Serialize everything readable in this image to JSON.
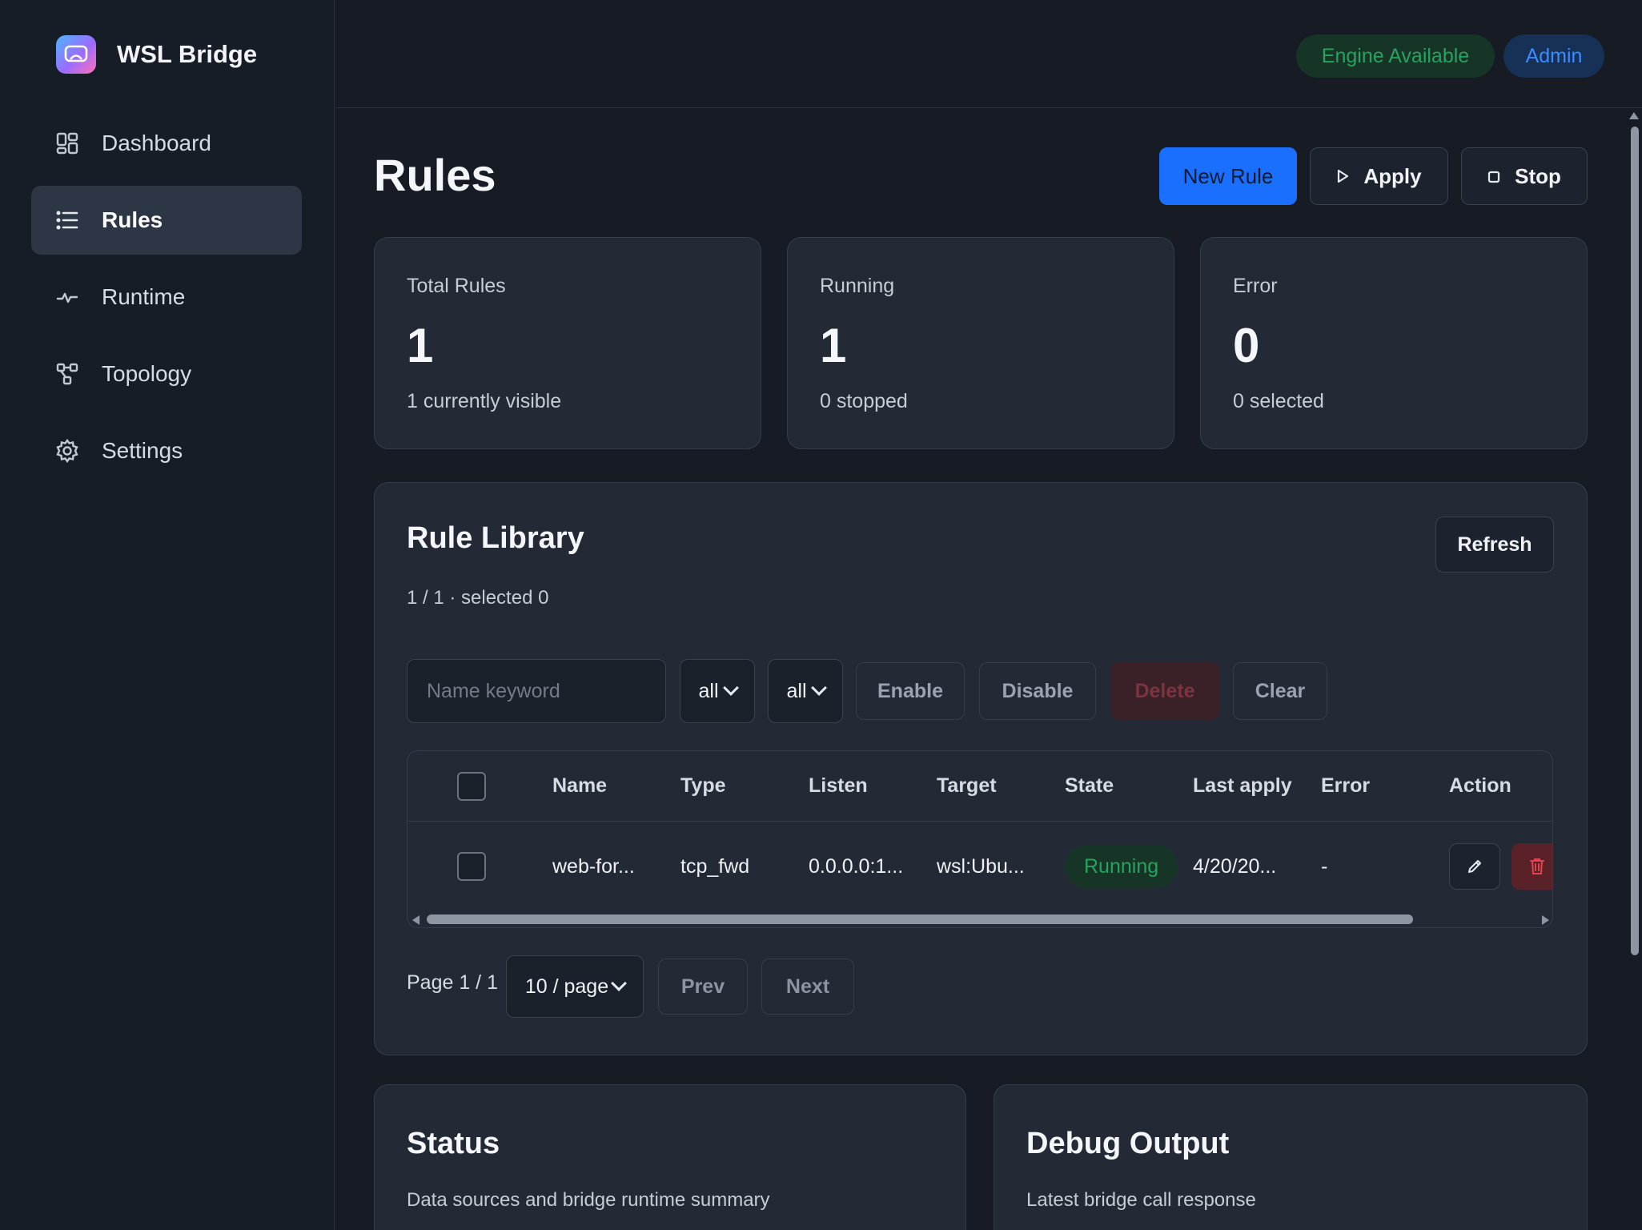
{
  "app": {
    "title": "WSL Bridge",
    "logo_icon": "bridge-logo-icon"
  },
  "sidebar": {
    "items": [
      {
        "label": "Dashboard",
        "icon": "dashboard-icon",
        "active": false
      },
      {
        "label": "Rules",
        "icon": "list-icon",
        "active": true
      },
      {
        "label": "Runtime",
        "icon": "pulse-icon",
        "active": false
      },
      {
        "label": "Topology",
        "icon": "topology-icon",
        "active": false
      },
      {
        "label": "Settings",
        "icon": "gear-icon",
        "active": false
      }
    ]
  },
  "header": {
    "engine_status": "Engine Available",
    "role": "Admin"
  },
  "page": {
    "title": "Rules",
    "actions": {
      "new_rule": "New Rule",
      "apply": "Apply",
      "stop": "Stop"
    }
  },
  "stats": [
    {
      "label": "Total Rules",
      "value": "1",
      "sub": "1 currently visible"
    },
    {
      "label": "Running",
      "value": "1",
      "sub": "0 stopped"
    },
    {
      "label": "Error",
      "value": "0",
      "sub": "0 selected"
    }
  ],
  "library": {
    "title": "Rule Library",
    "summary": "1 / 1 · selected 0",
    "refresh": "Refresh",
    "filters": {
      "search_placeholder": "Name keyword",
      "search_value": "",
      "type_filter": "all",
      "state_filter": "all",
      "enable": "Enable",
      "disable": "Disable",
      "delete": "Delete",
      "clear": "Clear"
    },
    "columns": [
      "Name",
      "Type",
      "Listen",
      "Target",
      "State",
      "Last apply",
      "Error",
      "Action"
    ],
    "rows": [
      {
        "name": "web-for...",
        "type": "tcp_fwd",
        "listen": "0.0.0.0:1...",
        "target": "wsl:Ubu...",
        "state": "Running",
        "last_apply": "4/20/20...",
        "error": "-"
      }
    ],
    "pagination": {
      "page_info": "Page 1 / 1",
      "page_size": "10 / page",
      "prev": "Prev",
      "next": "Next"
    }
  },
  "status_panel": {
    "title": "Status",
    "description": "Data sources and bridge runtime summary"
  },
  "debug_panel": {
    "title": "Debug Output",
    "description": "Latest bridge call response"
  },
  "colors": {
    "background": "#161b24",
    "card": "#232a36",
    "accent_blue": "#1a6fff",
    "success_green": "#27a35f",
    "danger_red": "#e0454f"
  }
}
